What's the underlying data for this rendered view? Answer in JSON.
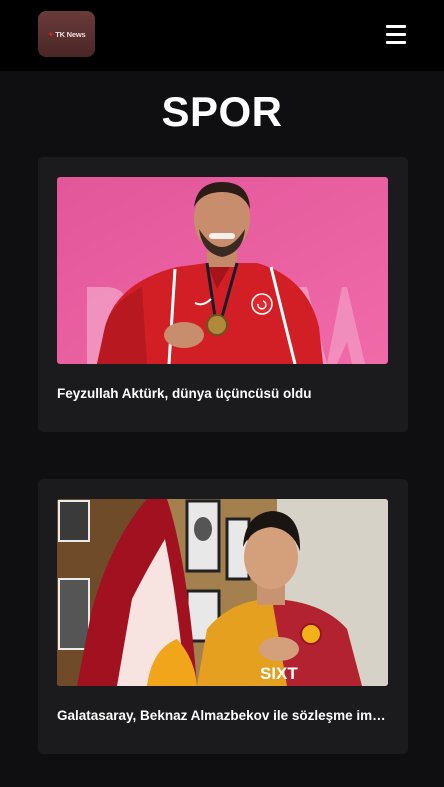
{
  "header": {
    "logo_text": "TK News",
    "menu_icon": "hamburger-menu-icon"
  },
  "page": {
    "title": "SPOR"
  },
  "articles": [
    {
      "title": "Feyzullah Aktürk, dünya üçüncüsü oldu"
    },
    {
      "title": "Galatasaray, Beknaz Almazbekov ile sözleşme imzaladı"
    }
  ]
}
